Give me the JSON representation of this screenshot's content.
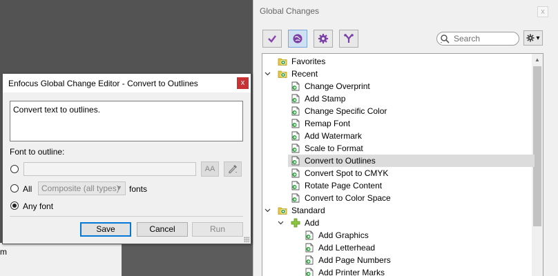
{
  "background": {
    "fragment_text": "m"
  },
  "global_changes": {
    "title": "Global Changes",
    "close_label": "x",
    "search_placeholder": "Search",
    "tree": [
      {
        "label": "Favorites",
        "level": 0,
        "expandable": false,
        "icon": "folder-icon"
      },
      {
        "label": "Recent",
        "level": 0,
        "expandable": true,
        "icon": "folder-icon"
      },
      {
        "label": "Change Overprint",
        "level": 1,
        "icon": "action-icon"
      },
      {
        "label": "Add Stamp",
        "level": 1,
        "icon": "action-icon"
      },
      {
        "label": "Change Specific Color",
        "level": 1,
        "icon": "action-icon"
      },
      {
        "label": "Remap Font",
        "level": 1,
        "icon": "action-icon"
      },
      {
        "label": "Add Watermark",
        "level": 1,
        "icon": "action-icon"
      },
      {
        "label": "Scale to Format",
        "level": 1,
        "icon": "action-icon"
      },
      {
        "label": "Convert to Outlines",
        "level": 1,
        "icon": "action-icon",
        "selected": true
      },
      {
        "label": "Convert Spot to CMYK",
        "level": 1,
        "icon": "action-icon"
      },
      {
        "label": "Rotate Page Content",
        "level": 1,
        "icon": "action-icon"
      },
      {
        "label": "Convert to Color Space",
        "level": 1,
        "icon": "action-icon"
      },
      {
        "label": "Standard",
        "level": 0,
        "expandable": true,
        "icon": "folder-icon"
      },
      {
        "label": "Add",
        "level": 1,
        "expandable": true,
        "icon": "plus-icon"
      },
      {
        "label": "Add Graphics",
        "level": 2,
        "icon": "action-icon"
      },
      {
        "label": "Add Letterhead",
        "level": 2,
        "icon": "action-icon"
      },
      {
        "label": "Add Page Numbers",
        "level": 2,
        "icon": "action-icon"
      },
      {
        "label": "Add Printer Marks",
        "level": 2,
        "icon": "action-icon"
      }
    ]
  },
  "editor": {
    "title": "Enfocus Global Change Editor - Convert to Outlines",
    "close_label": "x",
    "description": "Convert text to outlines.",
    "font_to_outline_label": "Font to outline:",
    "font_input_value": "",
    "font_picker_label": "AA",
    "all_label": "All",
    "composite_select_value": "Composite (all types)",
    "fonts_label": "fonts",
    "any_font_label": "Any font",
    "selected_option": "any_font",
    "buttons": {
      "save": "Save",
      "cancel": "Cancel",
      "run": "Run"
    }
  },
  "colors": {
    "accent_green": "#2e9e3f",
    "accent_purple": "#7a3fa8",
    "folder_yellow": "#e7c83d",
    "selection": "#dcdcdc"
  }
}
